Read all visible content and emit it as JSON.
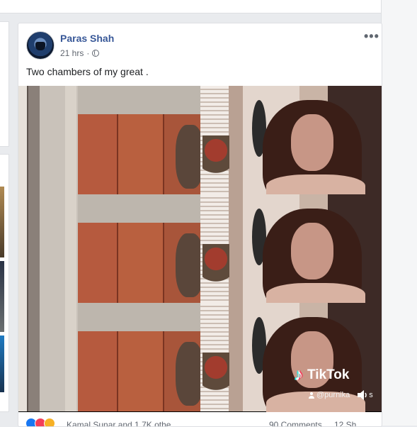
{
  "post": {
    "author": "Paras Shah",
    "time": "21 hrs",
    "dot": "·",
    "text": "Two chambers of my great .",
    "more": "•••"
  },
  "video": {
    "brand": "TikTok",
    "handle": "@purnika",
    "handle_suffix": "s"
  },
  "footer": {
    "reactors_partial": "Kamal Sunar and 1.7K othe",
    "comments_partial": "90 Comments",
    "shares_partial": "12 Sh"
  },
  "icons": {
    "globe": "globe-icon",
    "more": "more-icon",
    "speaker": "speaker-icon",
    "tiktok": "tiktok-icon"
  },
  "colors": {
    "name": "#385898",
    "background": "#e9ebee",
    "like": "#1877f2",
    "love": "#f33e58",
    "haha": "#f7b125"
  }
}
